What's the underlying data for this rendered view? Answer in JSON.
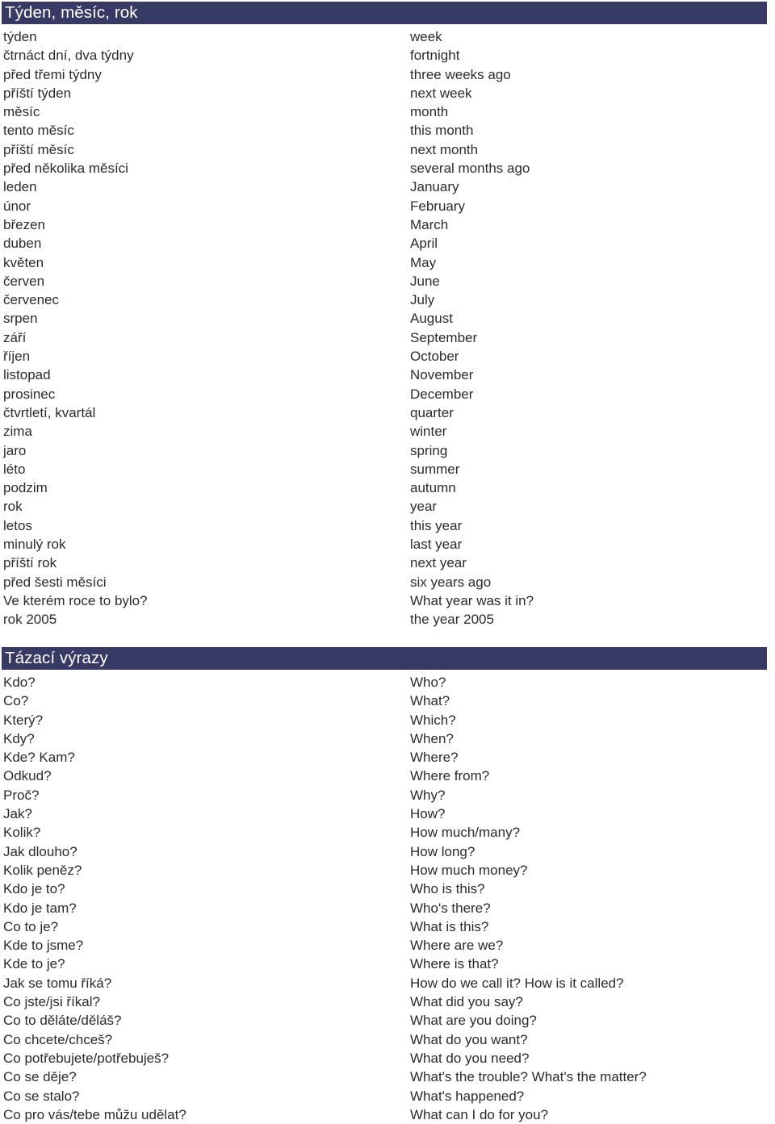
{
  "page": {
    "background_color": "#ffffff",
    "header_bar_color": "#383a66",
    "header_text_color": "#ffffff",
    "body_text_color": "#2b2b2b"
  },
  "sections": [
    {
      "title": "Týden, měsíc, rok",
      "entries": [
        {
          "cz": "týden",
          "en": "week"
        },
        {
          "cz": "čtrnáct dní, dva týdny",
          "en": "fortnight"
        },
        {
          "cz": "před třemi týdny",
          "en": "three weeks ago"
        },
        {
          "cz": "příští týden",
          "en": "next week"
        },
        {
          "cz": "měsíc",
          "en": "month"
        },
        {
          "cz": "tento měsíc",
          "en": "this month"
        },
        {
          "cz": "příští měsíc",
          "en": "next month"
        },
        {
          "cz": "před několika měsíci",
          "en": "several months ago"
        },
        {
          "cz": "leden",
          "en": "January"
        },
        {
          "cz": "únor",
          "en": "February"
        },
        {
          "cz": "březen",
          "en": "March"
        },
        {
          "cz": "duben",
          "en": "April"
        },
        {
          "cz": "květen",
          "en": "May"
        },
        {
          "cz": "červen",
          "en": "June"
        },
        {
          "cz": "červenec",
          "en": "July"
        },
        {
          "cz": "srpen",
          "en": "August"
        },
        {
          "cz": "září",
          "en": "September"
        },
        {
          "cz": "říjen",
          "en": "October"
        },
        {
          "cz": "listopad",
          "en": "November"
        },
        {
          "cz": "prosinec",
          "en": "December"
        },
        {
          "cz": "čtvrtletí, kvartál",
          "en": "quarter"
        },
        {
          "cz": "zima",
          "en": "winter"
        },
        {
          "cz": "jaro",
          "en": "spring"
        },
        {
          "cz": "léto",
          "en": "summer"
        },
        {
          "cz": "podzim",
          "en": "autumn"
        },
        {
          "cz": "rok",
          "en": "year"
        },
        {
          "cz": "letos",
          "en": "this year"
        },
        {
          "cz": "minulý rok",
          "en": "last year"
        },
        {
          "cz": "příští rok",
          "en": "next year"
        },
        {
          "cz": "před šesti měsíci",
          "en": "six years ago"
        },
        {
          "cz": "Ve kterém roce to bylo?",
          "en": "What year was it in?"
        },
        {
          "cz": "rok 2005",
          "en": "the year 2005"
        }
      ]
    },
    {
      "title": "Tázací výrazy",
      "entries": [
        {
          "cz": "Kdo?",
          "en": "Who?"
        },
        {
          "cz": "Co?",
          "en": "What?"
        },
        {
          "cz": "Který?",
          "en": "Which?"
        },
        {
          "cz": "Kdy?",
          "en": "When?"
        },
        {
          "cz": "Kde? Kam?",
          "en": "Where?"
        },
        {
          "cz": "Odkud?",
          "en": "Where from?"
        },
        {
          "cz": "Proč?",
          "en": "Why?"
        },
        {
          "cz": "Jak?",
          "en": "How?"
        },
        {
          "cz": "Kolik?",
          "en": "How much/many?"
        },
        {
          "cz": "Jak dlouho?",
          "en": "How long?"
        },
        {
          "cz": "Kolik peněz?",
          "en": "How much money?"
        },
        {
          "cz": "Kdo je to?",
          "en": "Who is this?"
        },
        {
          "cz": "Kdo je tam?",
          "en": "Who's there?"
        },
        {
          "cz": "Co to je?",
          "en": "What is this?"
        },
        {
          "cz": "Kde to jsme?",
          "en": "Where are we?"
        },
        {
          "cz": "Kde to je?",
          "en": "Where is that?"
        },
        {
          "cz": "Jak se tomu říká?",
          "en": "How do we call it? How is it called?"
        },
        {
          "cz": "Co jste/jsi říkal?",
          "en": "What did you say?"
        },
        {
          "cz": "Co to děláte/děláš?",
          "en": "What are you doing?"
        },
        {
          "cz": "Co chcete/chceš?",
          "en": "What do you want?"
        },
        {
          "cz": "Co potřebujete/potřebuješ?",
          "en": "What do you need?"
        },
        {
          "cz": "Co se děje?",
          "en": "What's the trouble? What's the matter?"
        },
        {
          "cz": "Co se stalo?",
          "en": "What's happened?"
        },
        {
          "cz": "Co pro vás/tebe můžu udělat?",
          "en": "What can I do for you?"
        }
      ]
    }
  ]
}
